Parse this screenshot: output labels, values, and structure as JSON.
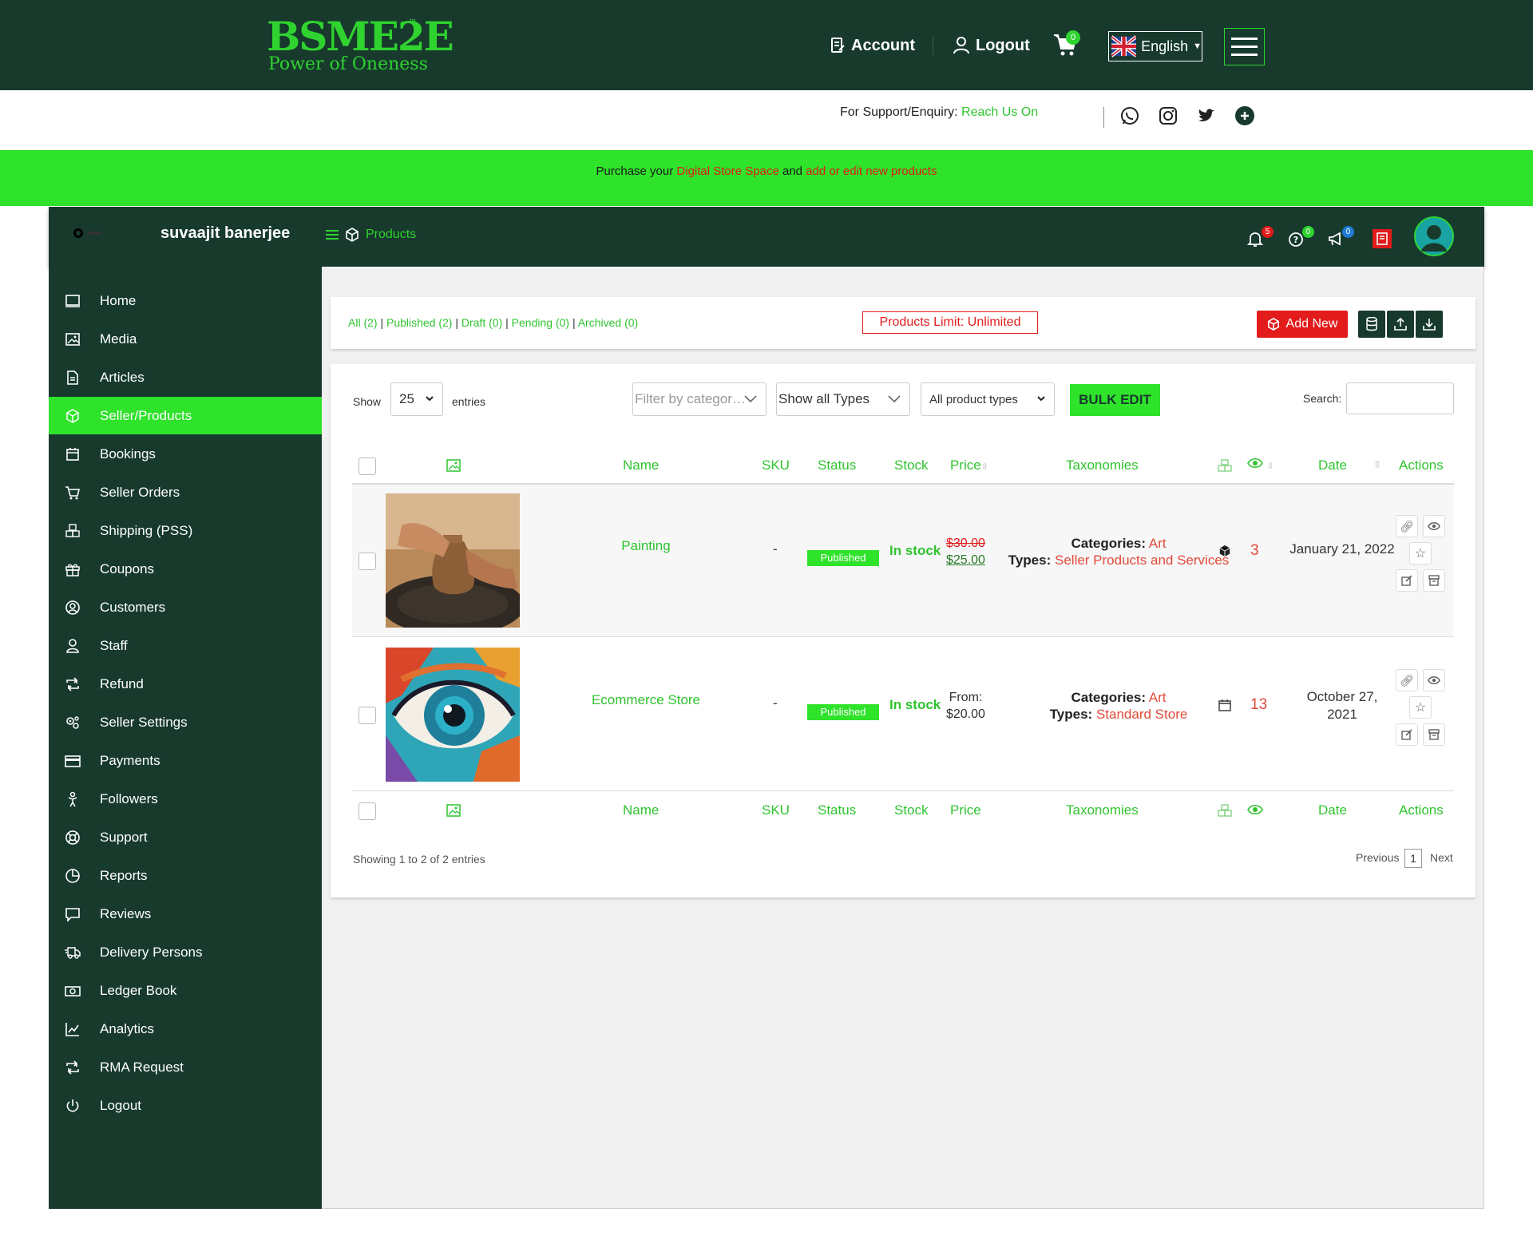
{
  "header": {
    "logo_main": "BSME2E",
    "logo_tm": "™",
    "logo_sub": "Power of Oneness",
    "account_label": "Account",
    "logout_label": "Logout",
    "cart_count": "0",
    "language": "English"
  },
  "support": {
    "prefix": "For Support/Enquiry:",
    "link": "Reach Us On"
  },
  "promo": {
    "part1": "Purchase your",
    "link1": "Digital Store Space",
    "part2": "and",
    "link2": "add or edit new products"
  },
  "panel": {
    "seller_name": "suvaajit banerjee",
    "breadcrumb": "Products",
    "notif_count": "5",
    "help_count": "0",
    "announce_count": "0"
  },
  "sidebar": {
    "items": [
      {
        "label": "Home",
        "icon": "monitor-icon"
      },
      {
        "label": "Media",
        "icon": "image-icon"
      },
      {
        "label": "Articles",
        "icon": "document-icon"
      },
      {
        "label": "Seller/Products",
        "icon": "cube-icon"
      },
      {
        "label": "Bookings",
        "icon": "calendar-icon"
      },
      {
        "label": "Seller Orders",
        "icon": "cart-icon"
      },
      {
        "label": "Shipping (PSS)",
        "icon": "boxes-icon"
      },
      {
        "label": "Coupons",
        "icon": "gift-icon"
      },
      {
        "label": "Customers",
        "icon": "user-circle-icon"
      },
      {
        "label": "Staff",
        "icon": "user-icon"
      },
      {
        "label": "Refund",
        "icon": "retweet-icon"
      },
      {
        "label": "Seller Settings",
        "icon": "cogs-icon"
      },
      {
        "label": "Payments",
        "icon": "credit-card-icon"
      },
      {
        "label": "Followers",
        "icon": "child-icon"
      },
      {
        "label": "Support",
        "icon": "life-ring-icon"
      },
      {
        "label": "Reports",
        "icon": "pie-chart-icon"
      },
      {
        "label": "Reviews",
        "icon": "comment-icon"
      },
      {
        "label": "Delivery Persons",
        "icon": "shipping-fast-icon"
      },
      {
        "label": "Ledger Book",
        "icon": "money-bill-icon"
      },
      {
        "label": "Analytics",
        "icon": "chart-line-icon"
      },
      {
        "label": "RMA Request",
        "icon": "retweet-icon"
      },
      {
        "label": "Logout",
        "icon": "power-icon"
      }
    ],
    "active_index": 3
  },
  "toolbar": {
    "filter_all": "All (2)",
    "filter_published": "Published (2)",
    "filter_draft": "Draft (0)",
    "filter_pending": "Pending (0)",
    "filter_archived": "Archived (0)",
    "sep": "|",
    "limit": "Products Limit: Unlimited",
    "add_new": "Add New"
  },
  "table_controls": {
    "show": "Show",
    "entries_value": "25",
    "entries": "entries",
    "category_placeholder": "Filter by categor…",
    "types_value": "Show all Types",
    "product_types_value": "All product types",
    "bulk_edit": "BULK EDIT",
    "search_label": "Search:"
  },
  "columns": {
    "name": "Name",
    "sku": "SKU",
    "status": "Status",
    "stock": "Stock",
    "price": "Price",
    "taxonomies": "Taxonomies",
    "date": "Date",
    "actions": "Actions"
  },
  "rows": [
    {
      "name": "Painting",
      "sku": "-",
      "status": "Published",
      "stock": "In stock",
      "price_old": "$30.00",
      "price_new": "$25.00",
      "categories_label": "Categories:",
      "categories": "Art",
      "types_label": "Types:",
      "types": "Seller Products and Services",
      "views": "3",
      "date": "January 21, 2022"
    },
    {
      "name": "Ecommerce Store",
      "sku": "-",
      "status": "Published",
      "stock": "In stock",
      "price_from": "From:",
      "price": "$20.00",
      "categories_label": "Categories:",
      "categories": "Art",
      "types_label": "Types:",
      "types": "Standard Store",
      "views": "13",
      "date_line1": "October 27,",
      "date_line2": "2021"
    }
  ],
  "pagination": {
    "info": "Showing 1 to 2 of 2 entries",
    "previous": "Previous",
    "page": "1",
    "next": "Next"
  },
  "colors": {
    "brand_dark": "#173a2d",
    "brand_green": "#2fe22a",
    "accent_red": "#e21b1b"
  }
}
